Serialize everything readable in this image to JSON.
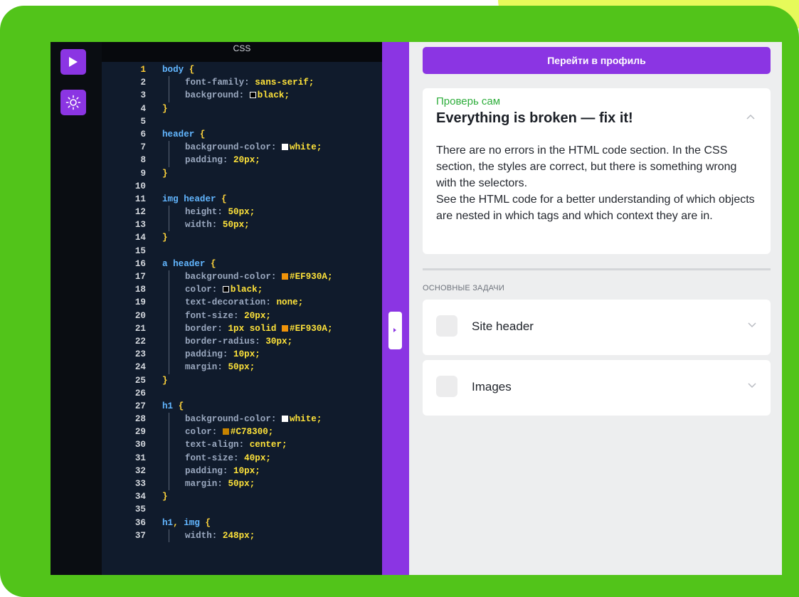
{
  "editor": {
    "tab_label": "CSS",
    "lines": [
      {
        "n": "1",
        "active": true,
        "guide": false,
        "tokens": [
          {
            "t": "sel",
            "v": "body "
          },
          {
            "t": "brace",
            "v": "{"
          }
        ]
      },
      {
        "n": "2",
        "guide": true,
        "tokens": [
          {
            "t": "prop",
            "v": "font-family: "
          },
          {
            "t": "val",
            "v": "sans-serif;"
          }
        ]
      },
      {
        "n": "3",
        "guide": true,
        "tokens": [
          {
            "t": "prop",
            "v": "background: "
          },
          {
            "t": "swatch",
            "c": "black"
          },
          {
            "t": "val",
            "v": "black;"
          }
        ]
      },
      {
        "n": "4",
        "guide": false,
        "tokens": [
          {
            "t": "brace",
            "v": "}"
          }
        ]
      },
      {
        "n": "5",
        "guide": false,
        "tokens": []
      },
      {
        "n": "6",
        "guide": false,
        "tokens": [
          {
            "t": "sel",
            "v": "header "
          },
          {
            "t": "brace",
            "v": "{"
          }
        ]
      },
      {
        "n": "7",
        "guide": true,
        "tokens": [
          {
            "t": "prop",
            "v": "background-color: "
          },
          {
            "t": "swatch",
            "c": "white"
          },
          {
            "t": "val",
            "v": "white;"
          }
        ]
      },
      {
        "n": "8",
        "guide": true,
        "tokens": [
          {
            "t": "prop",
            "v": "padding: "
          },
          {
            "t": "val",
            "v": "20px;"
          }
        ]
      },
      {
        "n": "9",
        "guide": false,
        "tokens": [
          {
            "t": "brace",
            "v": "}"
          }
        ]
      },
      {
        "n": "10",
        "guide": false,
        "tokens": []
      },
      {
        "n": "11",
        "guide": false,
        "tokens": [
          {
            "t": "sel",
            "v": "img header "
          },
          {
            "t": "brace",
            "v": "{"
          }
        ]
      },
      {
        "n": "12",
        "guide": true,
        "tokens": [
          {
            "t": "prop",
            "v": "height: "
          },
          {
            "t": "val",
            "v": "50px;"
          }
        ]
      },
      {
        "n": "13",
        "guide": true,
        "tokens": [
          {
            "t": "prop",
            "v": "width: "
          },
          {
            "t": "val",
            "v": "50px;"
          }
        ]
      },
      {
        "n": "14",
        "guide": false,
        "tokens": [
          {
            "t": "brace",
            "v": "}"
          }
        ]
      },
      {
        "n": "15",
        "guide": false,
        "tokens": []
      },
      {
        "n": "16",
        "guide": false,
        "tokens": [
          {
            "t": "sel",
            "v": "a header "
          },
          {
            "t": "brace",
            "v": "{"
          }
        ]
      },
      {
        "n": "17",
        "guide": true,
        "tokens": [
          {
            "t": "prop",
            "v": "background-color: "
          },
          {
            "t": "swatch",
            "c": "orange"
          },
          {
            "t": "val",
            "v": "#EF930A;"
          }
        ]
      },
      {
        "n": "18",
        "guide": true,
        "tokens": [
          {
            "t": "prop",
            "v": "color: "
          },
          {
            "t": "swatch",
            "c": "black"
          },
          {
            "t": "val",
            "v": "black;"
          }
        ]
      },
      {
        "n": "19",
        "guide": true,
        "tokens": [
          {
            "t": "prop",
            "v": "text-decoration: "
          },
          {
            "t": "val",
            "v": "none;"
          }
        ]
      },
      {
        "n": "20",
        "guide": true,
        "tokens": [
          {
            "t": "prop",
            "v": "font-size: "
          },
          {
            "t": "val",
            "v": "20px;"
          }
        ]
      },
      {
        "n": "21",
        "guide": true,
        "tokens": [
          {
            "t": "prop",
            "v": "border: "
          },
          {
            "t": "val",
            "v": "1px solid "
          },
          {
            "t": "swatch",
            "c": "orange"
          },
          {
            "t": "val",
            "v": "#EF930A;"
          }
        ]
      },
      {
        "n": "22",
        "guide": true,
        "tokens": [
          {
            "t": "prop",
            "v": "border-radius: "
          },
          {
            "t": "val",
            "v": "30px;"
          }
        ]
      },
      {
        "n": "23",
        "guide": true,
        "tokens": [
          {
            "t": "prop",
            "v": "padding: "
          },
          {
            "t": "val",
            "v": "10px;"
          }
        ]
      },
      {
        "n": "24",
        "guide": true,
        "tokens": [
          {
            "t": "prop",
            "v": "margin: "
          },
          {
            "t": "val",
            "v": "50px;"
          }
        ]
      },
      {
        "n": "25",
        "guide": false,
        "tokens": [
          {
            "t": "brace",
            "v": "}"
          }
        ]
      },
      {
        "n": "26",
        "guide": false,
        "tokens": []
      },
      {
        "n": "27",
        "guide": false,
        "tokens": [
          {
            "t": "sel",
            "v": "h1 "
          },
          {
            "t": "brace",
            "v": "{"
          }
        ]
      },
      {
        "n": "28",
        "guide": true,
        "tokens": [
          {
            "t": "prop",
            "v": "background-color: "
          },
          {
            "t": "swatch",
            "c": "white"
          },
          {
            "t": "val",
            "v": "white;"
          }
        ]
      },
      {
        "n": "29",
        "guide": true,
        "tokens": [
          {
            "t": "prop",
            "v": "color: "
          },
          {
            "t": "swatch",
            "c": "dorange"
          },
          {
            "t": "val",
            "v": "#C78300;"
          }
        ]
      },
      {
        "n": "30",
        "guide": true,
        "tokens": [
          {
            "t": "prop",
            "v": "text-align: "
          },
          {
            "t": "val",
            "v": "center;"
          }
        ]
      },
      {
        "n": "31",
        "guide": true,
        "tokens": [
          {
            "t": "prop",
            "v": "font-size: "
          },
          {
            "t": "val",
            "v": "40px;"
          }
        ]
      },
      {
        "n": "32",
        "guide": true,
        "tokens": [
          {
            "t": "prop",
            "v": "padding: "
          },
          {
            "t": "val",
            "v": "10px;"
          }
        ]
      },
      {
        "n": "33",
        "guide": true,
        "tokens": [
          {
            "t": "prop",
            "v": "margin: "
          },
          {
            "t": "val",
            "v": "50px;"
          }
        ]
      },
      {
        "n": "34",
        "guide": false,
        "tokens": [
          {
            "t": "brace",
            "v": "}"
          }
        ]
      },
      {
        "n": "35",
        "guide": false,
        "tokens": []
      },
      {
        "n": "36",
        "guide": false,
        "tokens": [
          {
            "t": "sel",
            "v": "h1"
          },
          {
            "t": "brace",
            "v": ", "
          },
          {
            "t": "sel",
            "v": "img "
          },
          {
            "t": "brace",
            "v": "{"
          }
        ]
      },
      {
        "n": "37",
        "guide": true,
        "tokens": [
          {
            "t": "prop",
            "v": "width: "
          },
          {
            "t": "val",
            "v": "248px;"
          }
        ]
      }
    ]
  },
  "toolbar": {
    "run_icon": "play-icon",
    "theme_icon": "sun-icon"
  },
  "panel": {
    "profile_button": "Перейти в профиль",
    "task": {
      "eyebrow": "Проверь сам",
      "title": "Everything is broken — fix it!",
      "paragraph1": "There are no errors in the HTML code section. In the CSS section, the styles are correct, but there is something wrong with the selectors.",
      "paragraph2": "See the HTML code for a better understanding of which objects are nested in which tags and which context they are in."
    },
    "section_label": "ОСНОВНЫЕ ЗАДАЧИ",
    "subtasks": [
      {
        "label": "Site header",
        "checked": false
      },
      {
        "label": "Images",
        "checked": false
      }
    ]
  },
  "colors": {
    "accent": "#8B35E3",
    "frame_green": "#52C41A",
    "eyebrow_green": "#2FAE3C",
    "editor_bg": "#101B2C"
  }
}
